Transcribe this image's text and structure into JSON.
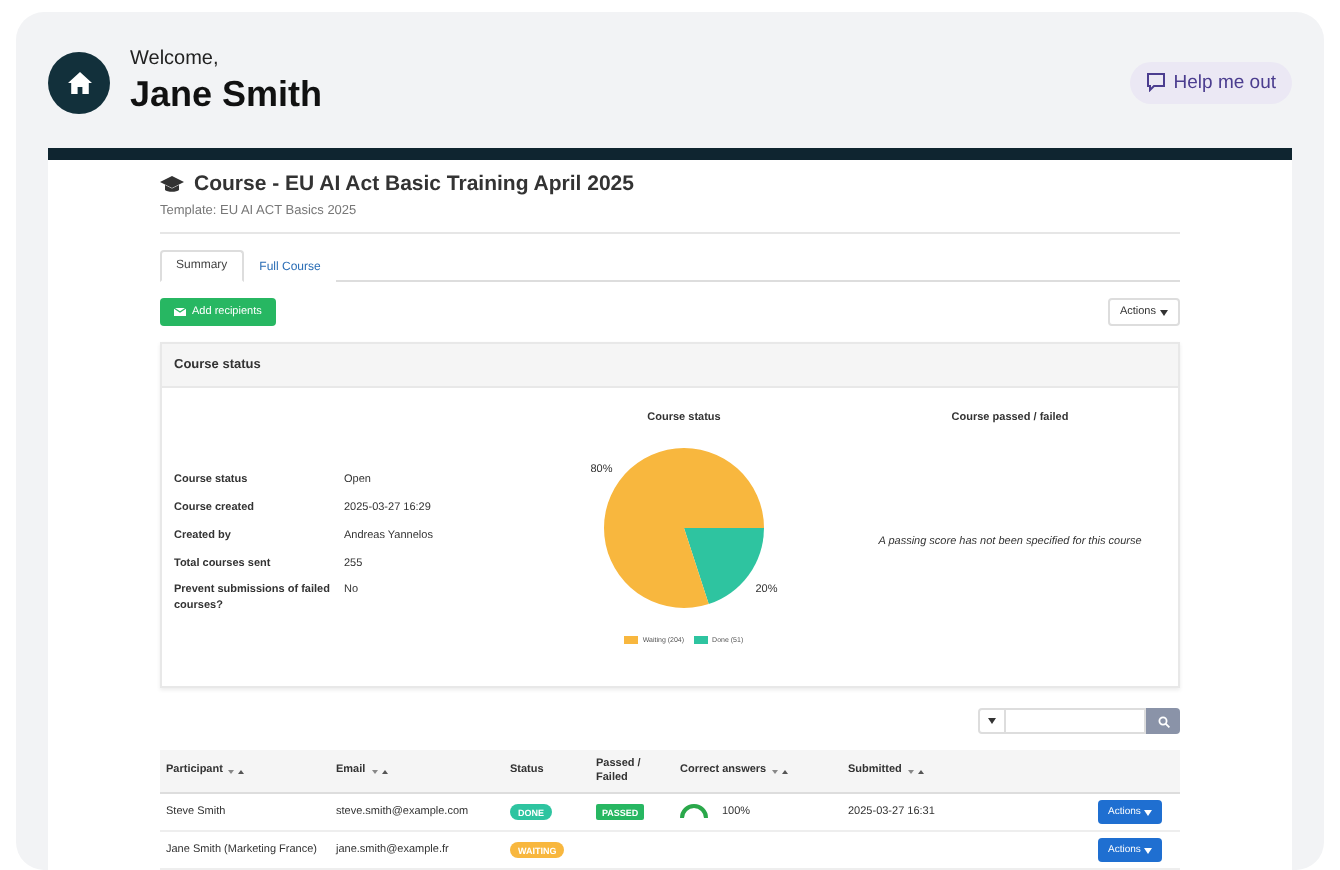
{
  "header": {
    "greeting": "Welcome,",
    "name": "Jane Smith",
    "help_button": "Help me out"
  },
  "course": {
    "title": "Course - EU AI Act Basic Training April 2025",
    "template": "Template: EU AI ACT Basics 2025"
  },
  "tabs": [
    {
      "label": "Summary",
      "selected": true
    },
    {
      "label": "Full Course",
      "selected": false
    }
  ],
  "add_button": "Add recipients",
  "actions_button": "Actions",
  "status_panel": {
    "title": "Course status",
    "details": [
      {
        "label": "Course status",
        "value": "Open"
      },
      {
        "label": "Course created",
        "value": "2025-03-27 16:29"
      },
      {
        "label": "Created by",
        "value": "Andreas Yannelos"
      },
      {
        "label": "Total courses sent",
        "value": "255"
      },
      {
        "label": "Prevent submissions of failed courses?",
        "value": "No"
      }
    ],
    "chart": {
      "chart_data": {
        "type": "pie",
        "title": "Course status",
        "categories": [
          "Waiting (204)",
          "Done (51)"
        ],
        "values": [
          80,
          20
        ],
        "value_labels": [
          "80%",
          "20%"
        ]
      }
    },
    "passed": {
      "title": "Course passed / failed",
      "message": "A passing score has not been specified for this course"
    }
  },
  "table": {
    "columns": [
      {
        "label": "Participant",
        "sortable": true
      },
      {
        "label": "Email",
        "sortable": true
      },
      {
        "label": "Status",
        "sortable": false
      },
      {
        "label": "Passed / Failed",
        "sortable": false
      },
      {
        "label": "Correct answers",
        "sortable": true
      },
      {
        "label": "Submitted",
        "sortable": true
      }
    ],
    "rows": [
      {
        "participant": "Steve Smith",
        "email": "steve.smith@example.com",
        "status": {
          "label": "DONE",
          "kind": "done"
        },
        "result": "PASSED",
        "correct": {
          "level": 1,
          "reading": "100%"
        },
        "submitted": "2025-03-27 16:31",
        "action": "Actions"
      },
      {
        "participant": "Jane Smith (Marketing France)",
        "email": "jane.smith@example.fr",
        "status": {
          "label": "WAITING",
          "kind": "waiting"
        },
        "action": "Actions"
      }
    ]
  }
}
